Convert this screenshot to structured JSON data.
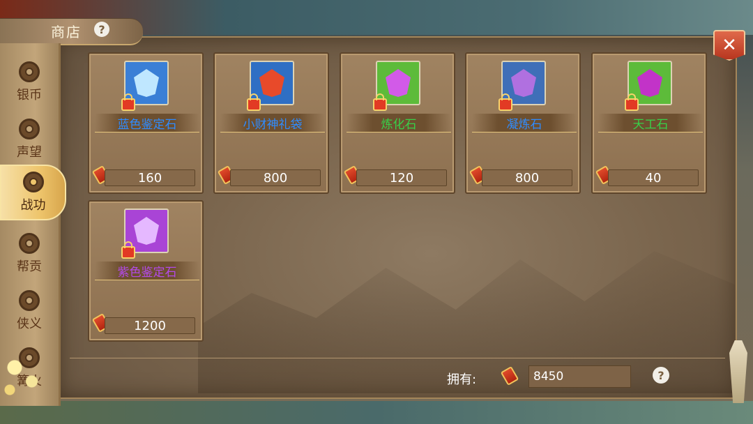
{
  "shop": {
    "title": "商店",
    "close_label": "✕",
    "help_label": "?"
  },
  "sidebar": {
    "items": [
      {
        "label": "银币",
        "icon": "coin-icon"
      },
      {
        "label": "声望",
        "icon": "reputation-icon"
      },
      {
        "label": "战功",
        "icon": "merit-icon",
        "active": true
      },
      {
        "label": "帮贡",
        "icon": "guild-icon"
      },
      {
        "label": "侠义",
        "icon": "chivalry-icon"
      },
      {
        "label": "篝火",
        "icon": "campfire-icon"
      }
    ]
  },
  "goods": [
    {
      "name": "蓝色鉴定石",
      "price": "160",
      "name_color": "#2f8cff",
      "icon_bg": "#3a7fd6",
      "gem_color": "#bfe7ff"
    },
    {
      "name": "小财神礼袋",
      "price": "800",
      "name_color": "#2f8cff",
      "icon_bg": "#2f6fc4",
      "gem_color": "#e84a2a"
    },
    {
      "name": "炼化石",
      "price": "120",
      "name_color": "#38d048",
      "icon_bg": "#5dbb3a",
      "gem_color": "#d25ae8"
    },
    {
      "name": "凝炼石",
      "price": "800",
      "name_color": "#2f8cff",
      "icon_bg": "#3f6fb8",
      "gem_color": "#b070e0"
    },
    {
      "name": "天工石",
      "price": "40",
      "name_color": "#38d048",
      "icon_bg": "#5dbb3a",
      "gem_color": "#c233c8"
    },
    {
      "name": "紫色鉴定石",
      "price": "1200",
      "name_color": "#b34ae8",
      "icon_bg": "#a944d6",
      "gem_color": "#e5b8ff"
    }
  ],
  "footer": {
    "owned_label": "拥有:",
    "owned_value": "8450",
    "help_label": "?"
  },
  "colors": {
    "accent": "#eec56c",
    "close": "#c9432a"
  }
}
